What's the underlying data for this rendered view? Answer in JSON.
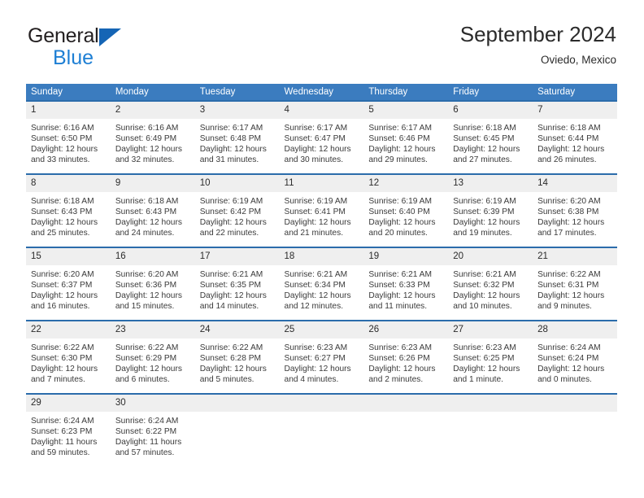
{
  "brand": {
    "line1": "General",
    "line2": "Blue",
    "triangle_color": "#1565b5",
    "blue_text_color": "#1e7fd4"
  },
  "header": {
    "title": "September 2024",
    "subtitle": "Oviedo, Mexico"
  },
  "theme": {
    "header_row_bg": "#3b7cbf",
    "daynum_bg": "#efefef",
    "cell_top_border": "#2b6cab",
    "text_color": "#3a3a3a"
  },
  "weekdays": [
    "Sunday",
    "Monday",
    "Tuesday",
    "Wednesday",
    "Thursday",
    "Friday",
    "Saturday"
  ],
  "labels": {
    "sunrise_prefix": "Sunrise:",
    "sunset_prefix": "Sunset:",
    "daylight_prefix": "Daylight:"
  },
  "weeks": [
    [
      {
        "day": "1",
        "sunrise": "Sunrise: 6:16 AM",
        "sunset": "Sunset: 6:50 PM",
        "daylight_line1": "Daylight: 12 hours",
        "daylight_line2": "and 33 minutes."
      },
      {
        "day": "2",
        "sunrise": "Sunrise: 6:16 AM",
        "sunset": "Sunset: 6:49 PM",
        "daylight_line1": "Daylight: 12 hours",
        "daylight_line2": "and 32 minutes."
      },
      {
        "day": "3",
        "sunrise": "Sunrise: 6:17 AM",
        "sunset": "Sunset: 6:48 PM",
        "daylight_line1": "Daylight: 12 hours",
        "daylight_line2": "and 31 minutes."
      },
      {
        "day": "4",
        "sunrise": "Sunrise: 6:17 AM",
        "sunset": "Sunset: 6:47 PM",
        "daylight_line1": "Daylight: 12 hours",
        "daylight_line2": "and 30 minutes."
      },
      {
        "day": "5",
        "sunrise": "Sunrise: 6:17 AM",
        "sunset": "Sunset: 6:46 PM",
        "daylight_line1": "Daylight: 12 hours",
        "daylight_line2": "and 29 minutes."
      },
      {
        "day": "6",
        "sunrise": "Sunrise: 6:18 AM",
        "sunset": "Sunset: 6:45 PM",
        "daylight_line1": "Daylight: 12 hours",
        "daylight_line2": "and 27 minutes."
      },
      {
        "day": "7",
        "sunrise": "Sunrise: 6:18 AM",
        "sunset": "Sunset: 6:44 PM",
        "daylight_line1": "Daylight: 12 hours",
        "daylight_line2": "and 26 minutes."
      }
    ],
    [
      {
        "day": "8",
        "sunrise": "Sunrise: 6:18 AM",
        "sunset": "Sunset: 6:43 PM",
        "daylight_line1": "Daylight: 12 hours",
        "daylight_line2": "and 25 minutes."
      },
      {
        "day": "9",
        "sunrise": "Sunrise: 6:18 AM",
        "sunset": "Sunset: 6:43 PM",
        "daylight_line1": "Daylight: 12 hours",
        "daylight_line2": "and 24 minutes."
      },
      {
        "day": "10",
        "sunrise": "Sunrise: 6:19 AM",
        "sunset": "Sunset: 6:42 PM",
        "daylight_line1": "Daylight: 12 hours",
        "daylight_line2": "and 22 minutes."
      },
      {
        "day": "11",
        "sunrise": "Sunrise: 6:19 AM",
        "sunset": "Sunset: 6:41 PM",
        "daylight_line1": "Daylight: 12 hours",
        "daylight_line2": "and 21 minutes."
      },
      {
        "day": "12",
        "sunrise": "Sunrise: 6:19 AM",
        "sunset": "Sunset: 6:40 PM",
        "daylight_line1": "Daylight: 12 hours",
        "daylight_line2": "and 20 minutes."
      },
      {
        "day": "13",
        "sunrise": "Sunrise: 6:19 AM",
        "sunset": "Sunset: 6:39 PM",
        "daylight_line1": "Daylight: 12 hours",
        "daylight_line2": "and 19 minutes."
      },
      {
        "day": "14",
        "sunrise": "Sunrise: 6:20 AM",
        "sunset": "Sunset: 6:38 PM",
        "daylight_line1": "Daylight: 12 hours",
        "daylight_line2": "and 17 minutes."
      }
    ],
    [
      {
        "day": "15",
        "sunrise": "Sunrise: 6:20 AM",
        "sunset": "Sunset: 6:37 PM",
        "daylight_line1": "Daylight: 12 hours",
        "daylight_line2": "and 16 minutes."
      },
      {
        "day": "16",
        "sunrise": "Sunrise: 6:20 AM",
        "sunset": "Sunset: 6:36 PM",
        "daylight_line1": "Daylight: 12 hours",
        "daylight_line2": "and 15 minutes."
      },
      {
        "day": "17",
        "sunrise": "Sunrise: 6:21 AM",
        "sunset": "Sunset: 6:35 PM",
        "daylight_line1": "Daylight: 12 hours",
        "daylight_line2": "and 14 minutes."
      },
      {
        "day": "18",
        "sunrise": "Sunrise: 6:21 AM",
        "sunset": "Sunset: 6:34 PM",
        "daylight_line1": "Daylight: 12 hours",
        "daylight_line2": "and 12 minutes."
      },
      {
        "day": "19",
        "sunrise": "Sunrise: 6:21 AM",
        "sunset": "Sunset: 6:33 PM",
        "daylight_line1": "Daylight: 12 hours",
        "daylight_line2": "and 11 minutes."
      },
      {
        "day": "20",
        "sunrise": "Sunrise: 6:21 AM",
        "sunset": "Sunset: 6:32 PM",
        "daylight_line1": "Daylight: 12 hours",
        "daylight_line2": "and 10 minutes."
      },
      {
        "day": "21",
        "sunrise": "Sunrise: 6:22 AM",
        "sunset": "Sunset: 6:31 PM",
        "daylight_line1": "Daylight: 12 hours",
        "daylight_line2": "and 9 minutes."
      }
    ],
    [
      {
        "day": "22",
        "sunrise": "Sunrise: 6:22 AM",
        "sunset": "Sunset: 6:30 PM",
        "daylight_line1": "Daylight: 12 hours",
        "daylight_line2": "and 7 minutes."
      },
      {
        "day": "23",
        "sunrise": "Sunrise: 6:22 AM",
        "sunset": "Sunset: 6:29 PM",
        "daylight_line1": "Daylight: 12 hours",
        "daylight_line2": "and 6 minutes."
      },
      {
        "day": "24",
        "sunrise": "Sunrise: 6:22 AM",
        "sunset": "Sunset: 6:28 PM",
        "daylight_line1": "Daylight: 12 hours",
        "daylight_line2": "and 5 minutes."
      },
      {
        "day": "25",
        "sunrise": "Sunrise: 6:23 AM",
        "sunset": "Sunset: 6:27 PM",
        "daylight_line1": "Daylight: 12 hours",
        "daylight_line2": "and 4 minutes."
      },
      {
        "day": "26",
        "sunrise": "Sunrise: 6:23 AM",
        "sunset": "Sunset: 6:26 PM",
        "daylight_line1": "Daylight: 12 hours",
        "daylight_line2": "and 2 minutes."
      },
      {
        "day": "27",
        "sunrise": "Sunrise: 6:23 AM",
        "sunset": "Sunset: 6:25 PM",
        "daylight_line1": "Daylight: 12 hours",
        "daylight_line2": "and 1 minute."
      },
      {
        "day": "28",
        "sunrise": "Sunrise: 6:24 AM",
        "sunset": "Sunset: 6:24 PM",
        "daylight_line1": "Daylight: 12 hours",
        "daylight_line2": "and 0 minutes."
      }
    ],
    [
      {
        "day": "29",
        "sunrise": "Sunrise: 6:24 AM",
        "sunset": "Sunset: 6:23 PM",
        "daylight_line1": "Daylight: 11 hours",
        "daylight_line2": "and 59 minutes."
      },
      {
        "day": "30",
        "sunrise": "Sunrise: 6:24 AM",
        "sunset": "Sunset: 6:22 PM",
        "daylight_line1": "Daylight: 11 hours",
        "daylight_line2": "and 57 minutes."
      },
      {
        "day": "",
        "sunrise": "",
        "sunset": "",
        "daylight_line1": "",
        "daylight_line2": ""
      },
      {
        "day": "",
        "sunrise": "",
        "sunset": "",
        "daylight_line1": "",
        "daylight_line2": ""
      },
      {
        "day": "",
        "sunrise": "",
        "sunset": "",
        "daylight_line1": "",
        "daylight_line2": ""
      },
      {
        "day": "",
        "sunrise": "",
        "sunset": "",
        "daylight_line1": "",
        "daylight_line2": ""
      },
      {
        "day": "",
        "sunrise": "",
        "sunset": "",
        "daylight_line1": "",
        "daylight_line2": ""
      }
    ]
  ]
}
